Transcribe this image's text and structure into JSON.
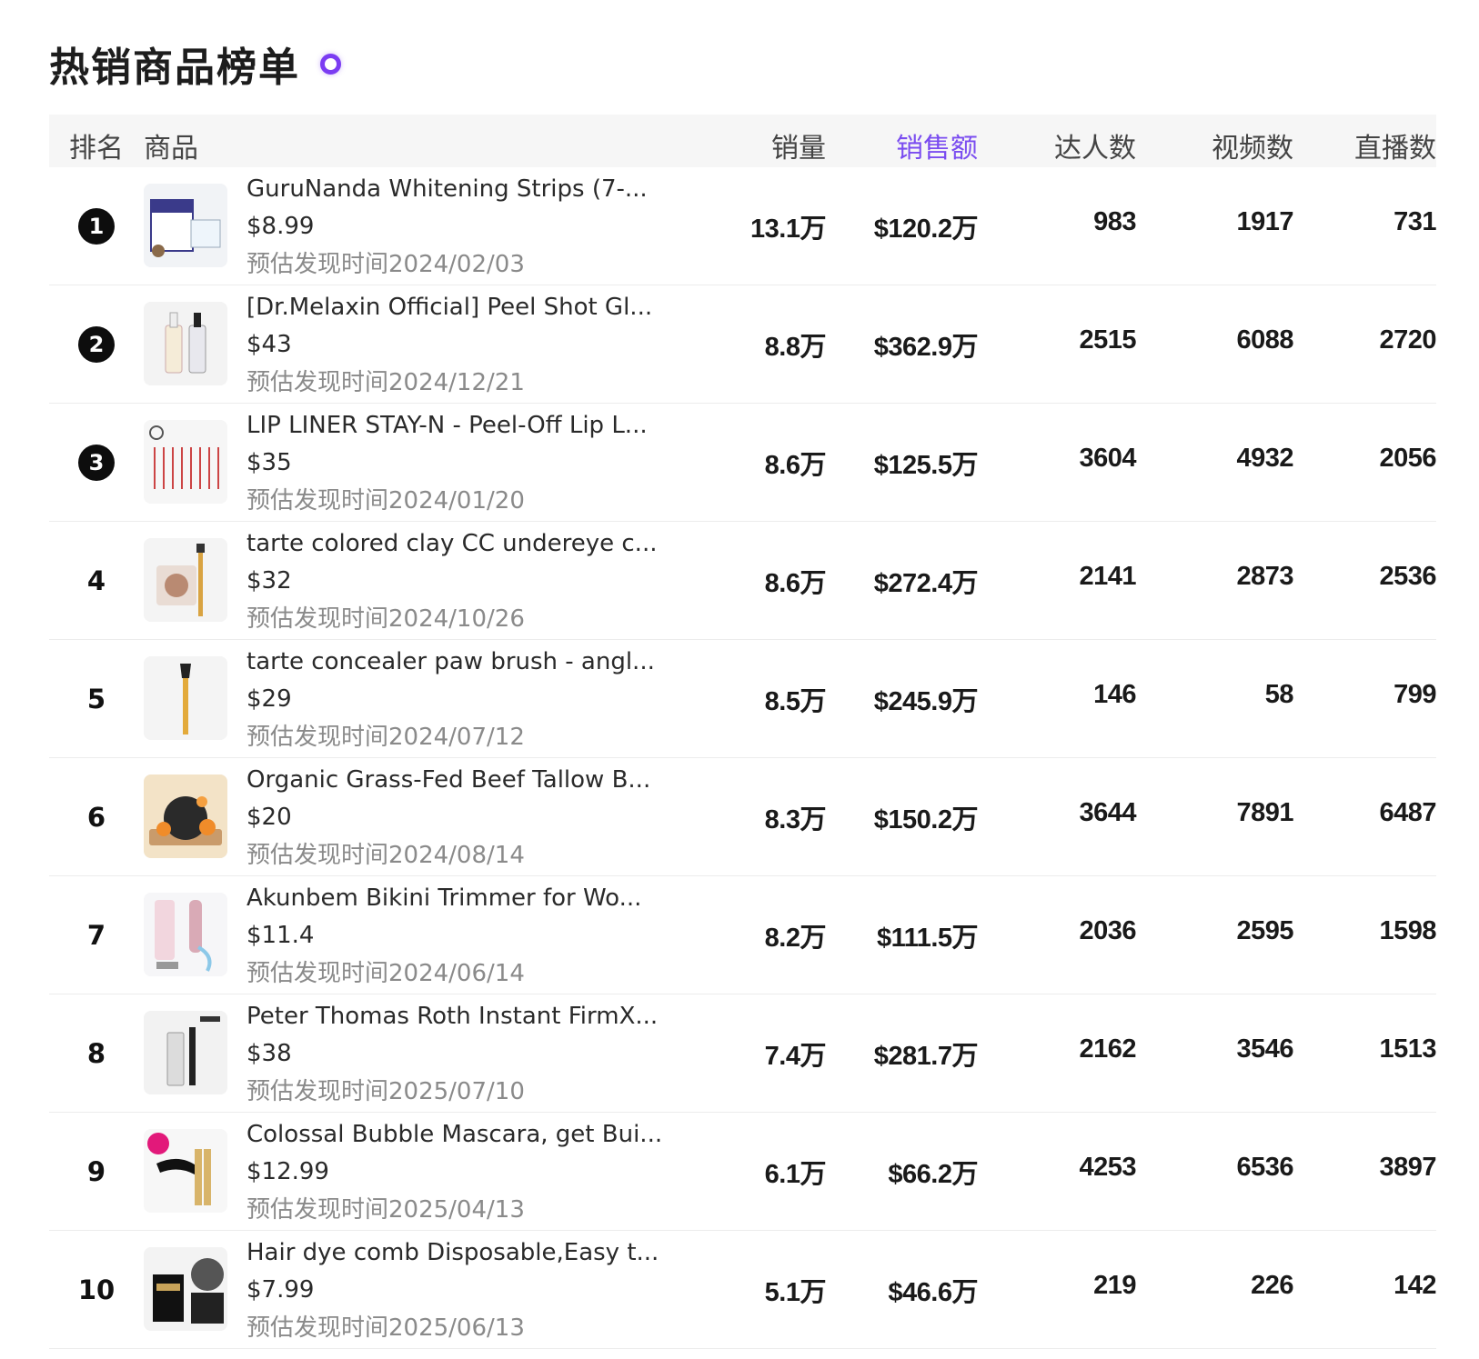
{
  "title": "热销商品榜单",
  "headers": {
    "rank": "排名",
    "product": "商品",
    "sales": "销量",
    "amount": "销售额",
    "kols": "达人数",
    "videos": "视频数",
    "lives": "直播数"
  },
  "colors": {
    "accent": "#7a4cf0",
    "header_bg": "#f6f6f6",
    "date_text": "#8a8a8a"
  },
  "rows": [
    {
      "rank": "1",
      "name": "GuruNanda Whitening Strips (7-...",
      "price": "$8.99",
      "date": "预估发现时间2024/02/03",
      "sales": "13.1万",
      "amount": "$120.2万",
      "kols": "983",
      "videos": "1917",
      "lives": "731"
    },
    {
      "rank": "2",
      "name": "[Dr.Melaxin Official] Peel Shot Gl...",
      "price": "$43",
      "date": "预估发现时间2024/12/21",
      "sales": "8.8万",
      "amount": "$362.9万",
      "kols": "2515",
      "videos": "6088",
      "lives": "2720"
    },
    {
      "rank": "3",
      "name": "LIP LINER STAY-N - Peel-Off Lip L...",
      "price": "$35",
      "date": "预估发现时间2024/01/20",
      "sales": "8.6万",
      "amount": "$125.5万",
      "kols": "3604",
      "videos": "4932",
      "lives": "2056"
    },
    {
      "rank": "4",
      "name": "tarte colored clay CC undereye c...",
      "price": "$32",
      "date": "预估发现时间2024/10/26",
      "sales": "8.6万",
      "amount": "$272.4万",
      "kols": "2141",
      "videos": "2873",
      "lives": "2536"
    },
    {
      "rank": "5",
      "name": "tarte concealer paw brush - angl...",
      "price": "$29",
      "date": "预估发现时间2024/07/12",
      "sales": "8.5万",
      "amount": "$245.9万",
      "kols": "146",
      "videos": "58",
      "lives": "799"
    },
    {
      "rank": "6",
      "name": "Organic Grass-Fed Beef Tallow B...",
      "price": "$20",
      "date": "预估发现时间2024/08/14",
      "sales": "8.3万",
      "amount": "$150.2万",
      "kols": "3644",
      "videos": "7891",
      "lives": "6487"
    },
    {
      "rank": "7",
      "name": "Akunbem Bikini Trimmer for Wo...",
      "price": "$11.4",
      "date": "预估发现时间2024/06/14",
      "sales": "8.2万",
      "amount": "$111.5万",
      "kols": "2036",
      "videos": "2595",
      "lives": "1598"
    },
    {
      "rank": "8",
      "name": "Peter Thomas Roth Instant FirmX...",
      "price": "$38",
      "date": "预估发现时间2025/07/10",
      "sales": "7.4万",
      "amount": "$281.7万",
      "kols": "2162",
      "videos": "3546",
      "lives": "1513"
    },
    {
      "rank": "9",
      "name": "Colossal Bubble Mascara, get Bui...",
      "price": "$12.99",
      "date": "预估发现时间2025/04/13",
      "sales": "6.1万",
      "amount": "$66.2万",
      "kols": "4253",
      "videos": "6536",
      "lives": "3897"
    },
    {
      "rank": "10",
      "name": "Hair dye comb Disposable,Easy t...",
      "price": "$7.99",
      "date": "预估发现时间2025/06/13",
      "sales": "5.1万",
      "amount": "$46.6万",
      "kols": "219",
      "videos": "226",
      "lives": "142"
    }
  ]
}
